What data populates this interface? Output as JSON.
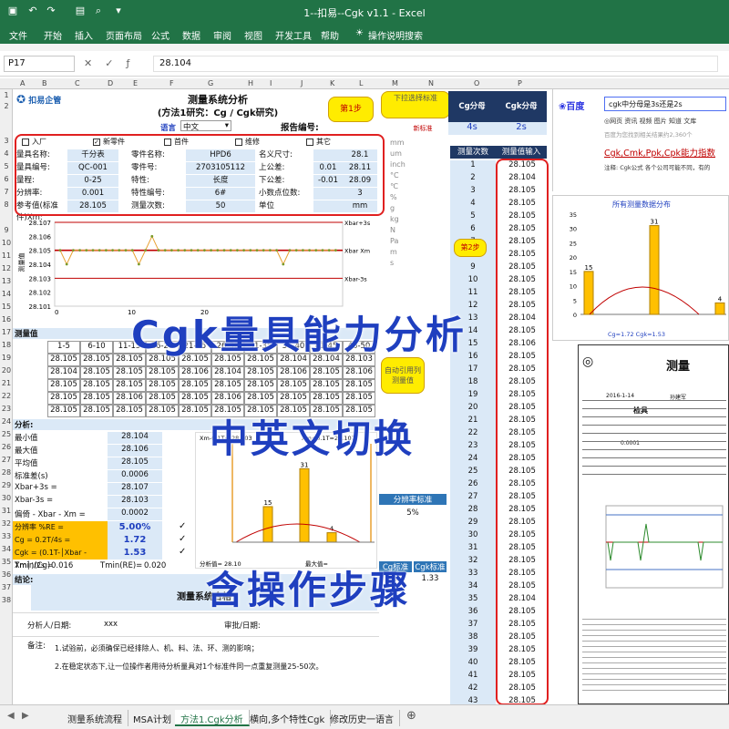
{
  "window": {
    "title": "1--扣易--Cgk v1.1  -  Excel"
  },
  "menu": [
    "文件",
    "开始",
    "插入",
    "页面布局",
    "公式",
    "数据",
    "审阅",
    "视图",
    "开发工具",
    "帮助",
    "操作说明搜索"
  ],
  "formula_bar": {
    "name_box": "P17",
    "value": "28.104"
  },
  "columns": [
    "A",
    "B",
    "C",
    "D",
    "E",
    "F",
    "G",
    "H",
    "I",
    "J",
    "K",
    "L",
    "M",
    "N",
    "O",
    "P"
  ],
  "header": {
    "logo": "扣易企管",
    "title": "测量系统分析",
    "subtitle": "(方法1研究：Cg / Cgk研究)",
    "lang_label": "语言",
    "lang_value": "中文",
    "report_no": "报告编号:",
    "step1": "第1步",
    "dropdown_hint": "下拉选择标准",
    "new_std": "新标准",
    "cg_denominator": "Cg分母",
    "cgk_denominator": "Cgk分母",
    "cg_den_val": "4s",
    "cgk_den_val": "2s"
  },
  "checks": [
    {
      "label": "入厂",
      "checked": false
    },
    {
      "label": "新零件",
      "checked": true
    },
    {
      "label": "首件",
      "checked": false
    },
    {
      "label": "维修",
      "checked": false
    },
    {
      "label": "其它",
      "checked": false
    }
  ],
  "info": [
    [
      "量具名称:",
      "千分表",
      "零件名称:",
      "HPD6",
      "名义尺寸:",
      "",
      "28.1"
    ],
    [
      "量具编号:",
      "QC-001",
      "零件号:",
      "2703105112",
      "上公差:",
      "0.01",
      "28.11"
    ],
    [
      "量程:",
      "0-25",
      "特性:",
      "长度",
      "下公差:",
      "-0.01",
      "28.09"
    ],
    [
      "分辨率:",
      "0.001",
      "特性编号:",
      "6#",
      "小数点位数:",
      "",
      "3"
    ],
    [
      "参考值(标准件)Xm:",
      "28.105",
      "测量次数:",
      "50",
      "单位",
      "",
      "mm"
    ]
  ],
  "units": [
    "mm",
    "um",
    "inch",
    "°C",
    "℃",
    "%",
    "g",
    "kg",
    "N",
    "Pa",
    "m",
    "s"
  ],
  "run_chart": {
    "y_ticks": [
      "28.107",
      "28.106",
      "28.105",
      "28.104",
      "28.103",
      "28.102",
      "28.101"
    ],
    "x_ticks": [
      "0",
      "10",
      "20"
    ],
    "ylabel": "测量值",
    "lines": [
      "Xbar+3s",
      "Xbar  Xm",
      "Xbar-3s"
    ]
  },
  "meas_section": {
    "title": "测量值",
    "headers": [
      "1-5",
      "6-10",
      "11-15",
      "16-20",
      "21-25",
      "26-30",
      "31-35",
      "36-40",
      "41-45",
      "46-50"
    ],
    "rows": [
      [
        "28.105",
        "28.105",
        "28.105",
        "28.105",
        "28.105",
        "28.105",
        "28.105",
        "28.104",
        "28.104",
        "28.103"
      ],
      [
        "28.104",
        "28.105",
        "28.105",
        "28.105",
        "28.106",
        "28.104",
        "28.105",
        "28.106",
        "28.105",
        "28.106"
      ],
      [
        "28.105",
        "28.105",
        "28.105",
        "28.105",
        "28.105",
        "28.105",
        "28.105",
        "28.105",
        "28.105",
        "28.105"
      ],
      [
        "28.105",
        "28.105",
        "28.106",
        "28.105",
        "28.105",
        "28.106",
        "28.105",
        "28.105",
        "28.105",
        "28.105"
      ],
      [
        "28.105",
        "28.105",
        "28.105",
        "28.105",
        "28.105",
        "28.105",
        "28.105",
        "28.105",
        "28.105",
        "28.105"
      ]
    ],
    "auto_hint": "自动引用列测量值"
  },
  "analysis": {
    "title": "分析:",
    "items": [
      [
        "最小值",
        "28.104"
      ],
      [
        "最大值",
        "28.106"
      ],
      [
        "平均值",
        "28.105"
      ],
      [
        "标准差(s)",
        "0.0006"
      ],
      [
        "Xbar+3s =",
        "28.107"
      ],
      [
        "Xbar-3s =",
        "28.103"
      ],
      [
        "偏倚 - Xbar - Xm =",
        "0.0002"
      ]
    ],
    "resolution": {
      "label": "分辨率    %RE =",
      "value": "5.00%"
    },
    "cg": {
      "label": "Cg = 0.2T/4s =",
      "value": "1.72"
    },
    "cgk": {
      "label": "Cgk = (0.1T-│Xbar - Xm│)/2s =",
      "value": "1.53"
    },
    "tmin_cg_label": "Tmin(Cg)",
    "tmin_cg": "0.016",
    "tmin_re_label": "Tmin(RE)=",
    "tmin_re": "0.020",
    "checks": [
      "✓",
      "✓",
      "✓"
    ],
    "hist_hint_left": "Xm-0.1T=  28.103",
    "hist_hint_right": "Xm+0.1T=28.107",
    "hist_label_a": "分析值=  28.10",
    "hist_label_b": "最大值=",
    "res_std_label": "分辨率标准",
    "res_std_value": "5%",
    "cg_std_label": "Cg标准",
    "cgk_std_label": "Cgk标准",
    "cg_std_value": "1.33",
    "cgk_std_value": "1.33"
  },
  "conclusion": {
    "title": "结论:",
    "value": "测量系统合格",
    "analyst_label": "分析人/日期:",
    "analyst_value": "xxx",
    "reviewer_label": "审批/日期:"
  },
  "notes": {
    "label": "备注:",
    "lines": [
      "1.试验前，必须确保已经排除人、机、料、法、环、测的影响；",
      "2.在稳定状态下,让一位操作者用待分析量具对1个标准件同一点重复测量25-50次。"
    ]
  },
  "entry_column": {
    "header_n": "测量次数",
    "header_v": "测量值输入",
    "step2": "第2步",
    "n": [
      "1",
      "2",
      "3",
      "4",
      "5",
      "6",
      "7",
      "8",
      "9",
      "10",
      "11",
      "12",
      "13",
      "14",
      "15",
      "16",
      "17",
      "18",
      "19",
      "20",
      "21",
      "22",
      "23",
      "24",
      "25",
      "26",
      "27",
      "28",
      "29",
      "30",
      "31",
      "32",
      "33",
      "34",
      "35",
      "36",
      "37",
      "38",
      "39",
      "40",
      "41",
      "42",
      "43"
    ],
    "v": [
      "28.105",
      "28.104",
      "28.105",
      "28.105",
      "28.105",
      "28.105",
      "28.105",
      "28.105",
      "28.105",
      "28.105",
      "28.105",
      "28.105",
      "28.104",
      "28.105",
      "28.106",
      "28.105",
      "28.105",
      "28.105",
      "28.105",
      "28.105",
      "28.105",
      "28.105",
      "28.105",
      "28.105",
      "28.105",
      "28.105",
      "28.105",
      "28.105",
      "28.105",
      "28.105",
      "28.105",
      "28.105",
      "28.105",
      "28.105",
      "28.104",
      "28.105",
      "28.105",
      "28.105",
      "28.105",
      "28.105",
      "28.105",
      "28.105",
      "28.105"
    ]
  },
  "baidu": {
    "query": "cgk中分母是3s还是2s",
    "result_title": "Cgk,Cmk,Ppk,Cpk能力指数",
    "result_desc": "注释: Cgk公式 各个公司可能不同，有的",
    "tabs": "◎网页   资讯   视频   图片   知道   文库",
    "count": "百度为您找到相关结果约2,360个"
  },
  "dist_chart": {
    "title": "所有测量数据分布",
    "y_ticks": [
      "35",
      "30",
      "25",
      "20",
      "15",
      "10",
      "5",
      "0"
    ],
    "bars": [
      15,
      31,
      4
    ],
    "labels_b": "Cg=1.72      Cgk=1.53"
  },
  "report": {
    "title": "测量",
    "subtitle": "检具",
    "date": "2016-1-14",
    "person": "孙建军",
    "res": "0.0001"
  },
  "tabs": [
    "测量系统流程",
    "MSA计划",
    "方法1.Cgk分析",
    "横向,多个特性Cgk",
    "修改历史一语言"
  ],
  "active_tab": "方法1.Cgk分析",
  "overlay": {
    "line1": "Cgk量具能力分析",
    "line2": "中英文切换",
    "line3": "含操作步骤"
  },
  "colors": {
    "excel_green": "#217346",
    "accent_blue": "#1f3fbf",
    "red": "#e02020",
    "yellow": "#ffec00"
  }
}
